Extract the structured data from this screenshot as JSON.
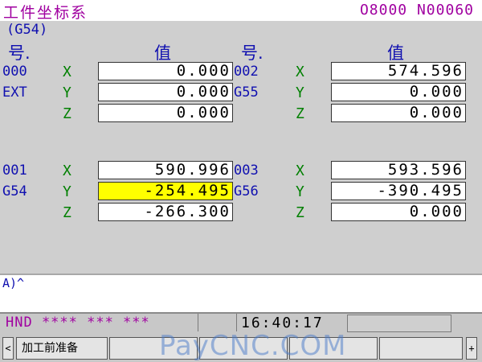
{
  "title_bar": {
    "title": "工件坐标系",
    "program_number": "O8000 N00060"
  },
  "panel": {
    "system_label": "(G54)",
    "col_header_no": "号.",
    "col_header_value": "值",
    "groups": [
      {
        "no": "000",
        "name": "EXT",
        "axes": [
          {
            "axis": "X",
            "value": "0.000"
          },
          {
            "axis": "Y",
            "value": "0.000"
          },
          {
            "axis": "Z",
            "value": "0.000"
          }
        ]
      },
      {
        "no": "002",
        "name": "G55",
        "axes": [
          {
            "axis": "X",
            "value": "574.596"
          },
          {
            "axis": "Y",
            "value": "0.000"
          },
          {
            "axis": "Z",
            "value": "0.000"
          }
        ]
      },
      {
        "no": "001",
        "name": "G54",
        "axes": [
          {
            "axis": "X",
            "value": "590.996"
          },
          {
            "axis": "Y",
            "value": "-254.495"
          },
          {
            "axis": "Z",
            "value": "-266.300"
          }
        ]
      },
      {
        "no": "003",
        "name": "G56",
        "axes": [
          {
            "axis": "X",
            "value": "593.596"
          },
          {
            "axis": "Y",
            "value": "-390.495"
          },
          {
            "axis": "Z",
            "value": "0.000"
          }
        ]
      }
    ]
  },
  "input_line": "A)^",
  "status_bar": {
    "mode": "HND **** *** ***",
    "time": "16:40:17"
  },
  "softkeys": {
    "left_arrow": "<",
    "right_arrow": "+",
    "key1": "加工前准备"
  },
  "watermark": "PayCNC.COM",
  "colors": {
    "title": "#a000a0",
    "label_blue": "#1010b0",
    "axis_green": "#008000",
    "highlight": "#ffff00",
    "panel_bg": "#cfcfcf"
  }
}
